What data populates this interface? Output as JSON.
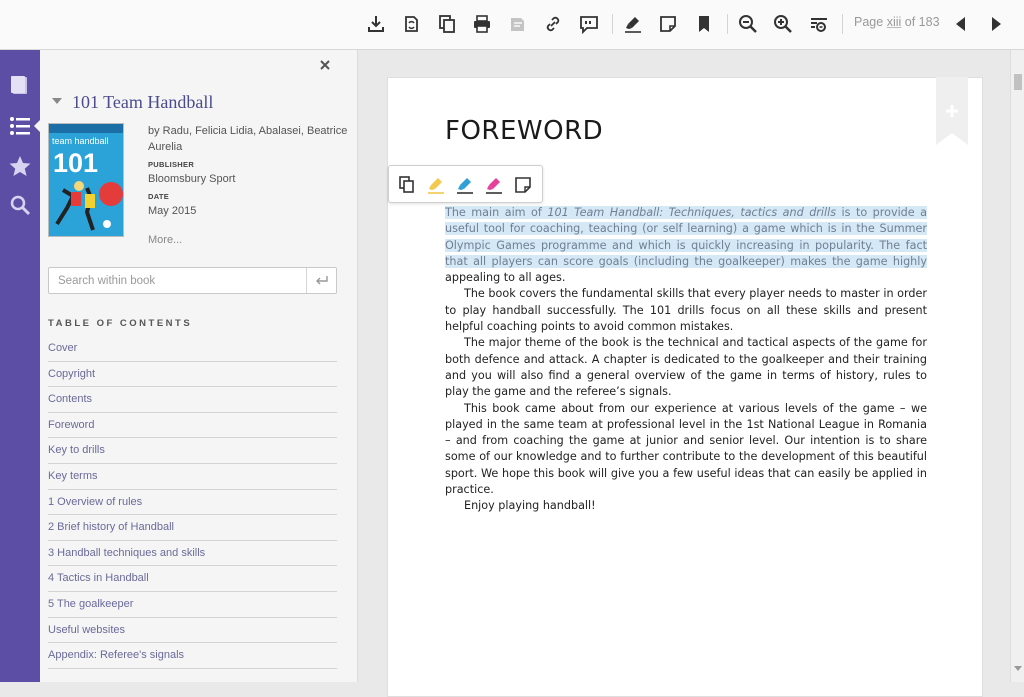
{
  "toolbar": {
    "page_label_prefix": "Page",
    "page_current": "xiii",
    "page_label_of": "of 183"
  },
  "sidebar": {
    "book": {
      "title": "101 Team Handball",
      "authors": "by Radu, Felicia Lidia, Abalasei, Beatrice Aurelia",
      "publisher_label": "PUBLISHER",
      "publisher": "Bloomsbury Sport",
      "date_label": "DATE",
      "date": "May 2015",
      "more": "More...",
      "cover_text": "team handball",
      "cover_number": "101"
    },
    "search": {
      "placeholder": "Search within book"
    },
    "toc": {
      "heading": "TABLE OF CONTENTS",
      "items": [
        "Cover",
        "Copyright",
        "Contents",
        "Foreword",
        "Key to drills",
        "Key terms",
        "1 Overview of rules",
        "2 Brief history of Handball",
        "3 Handball techniques and skills",
        "4 Tactics in Handball",
        "5 The goalkeeper",
        "Useful websites",
        "Appendix: Referee's signals"
      ]
    }
  },
  "page": {
    "heading": "FOREWORD",
    "highlight": {
      "pre": "The main aim of ",
      "italic": "101 Team Handball: Techniques, tactics and drills",
      "post": " is to provide a useful tool for coaching, teaching (or self learning) a game which is in the Summer Olympic Games programme and which is quickly increasing in popularity. The fact that all players can score goals (including the goalkeeper) makes the game highly"
    },
    "p1_rest": " appealing to all ages.",
    "p2": "The book covers the fundamental skills that every player needs to master in order to play handball successfully. The 101 drills focus on all these skills and present helpful coaching points to avoid common mistakes.",
    "p3": "The major theme of the book is the technical and tactical aspects of the game for both defence and attack. A chapter is dedicated to the goalkeeper and their training and you will also find a general overview of the game in terms of history, rules to play the game and the referee’s signals.",
    "p4": "This book came about from our experience at various levels of the game – we played in the same team at professional level in the 1st National League in Romania – and from coaching the game at junior and senior level. Our intention is to share some of our knowledge and to further contribute to the development of this beautiful sport. We hope this book will give you a few useful ideas that can easily be applied in practice.",
    "p5": "Enjoy playing handball!"
  },
  "colors": {
    "rail": "#5b4ea4",
    "title_link": "#4a4c8c",
    "highlight_yellow": "#f2c94c",
    "highlight_blue": "#2f9fd8",
    "highlight_pink": "#e5409a",
    "selection": "#d4e9f5"
  }
}
